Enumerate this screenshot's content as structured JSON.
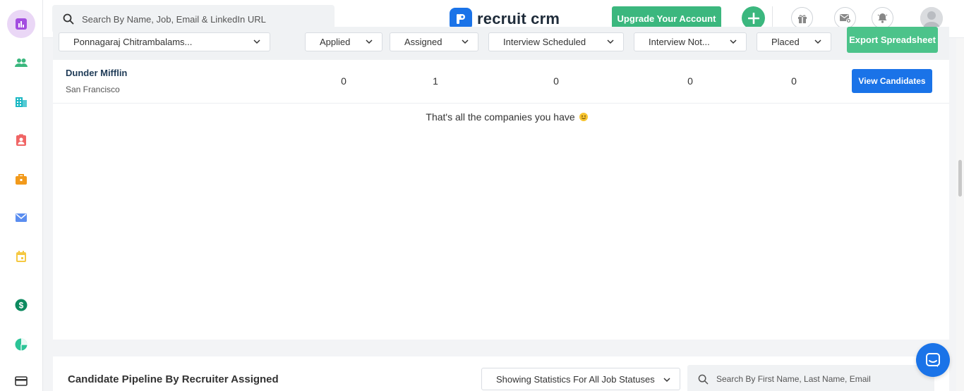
{
  "sidebar": {
    "items": [
      {
        "name": "dashboard-icon",
        "color": "#a34ee0",
        "active": true
      },
      {
        "name": "candidates-icon",
        "color": "#3bb77e"
      },
      {
        "name": "companies-icon",
        "color": "#1cb8c4"
      },
      {
        "name": "contacts-icon",
        "color": "#f06565"
      },
      {
        "name": "jobs-icon",
        "color": "#f29a1b"
      },
      {
        "name": "email-icon",
        "color": "#5b8ef0"
      },
      {
        "name": "calendar-icon",
        "color": "#f5c842"
      },
      {
        "name": "billing-icon",
        "color": "#0d8a5f"
      },
      {
        "name": "reports-icon",
        "color": "#2cc497"
      },
      {
        "name": "card-icon",
        "color": "#333333"
      }
    ]
  },
  "header": {
    "search_placeholder": "Search By Name, Job, Email & LinkedIn URL",
    "logo_text": "recruit crm",
    "upgrade_label": "Upgrade Your Account",
    "brand_color": "#1a73e8",
    "accent_color": "#3bb77e"
  },
  "filters": {
    "recruiter": "Ponnagaraj Chitrambalams...",
    "applied": "Applied",
    "assigned": "Assigned",
    "interview_scheduled": "Interview Scheduled",
    "interview_not": "Interview Not...",
    "placed": "Placed",
    "export_label": "Export Spreadsheet"
  },
  "companies": [
    {
      "name": "Dunder Mifflin",
      "location": "San Francisco",
      "applied": "0",
      "assigned": "1",
      "interview_scheduled": "0",
      "interview_not": "0",
      "placed": "0",
      "action_label": "View Candidates"
    }
  ],
  "end_message": "That's all the companies you have",
  "pipeline": {
    "title": "Candidate Pipeline By Recruiter Assigned",
    "status_filter": "Showing Statistics For All Job Statuses",
    "search_placeholder": "Search By First Name, Last Name, Email"
  }
}
